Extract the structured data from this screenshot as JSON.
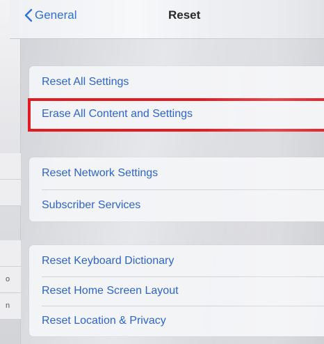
{
  "nav": {
    "back_label": "General",
    "title": "Reset"
  },
  "groups": [
    {
      "items": [
        {
          "label": "Reset All Settings"
        },
        {
          "label": "Erase All Content and Settings",
          "highlighted": true
        }
      ]
    },
    {
      "items": [
        {
          "label": "Reset Network Settings"
        },
        {
          "label": "Subscriber Services"
        }
      ]
    },
    {
      "items": [
        {
          "label": "Reset Keyboard Dictionary"
        },
        {
          "label": "Reset Home Screen Layout"
        },
        {
          "label": "Reset Location & Privacy"
        }
      ]
    }
  ],
  "sidebar_fragments": [
    "o",
    "n"
  ],
  "colors": {
    "accent": "#2e64c8",
    "highlight": "#e01c22",
    "background": "#dfe0e5"
  }
}
